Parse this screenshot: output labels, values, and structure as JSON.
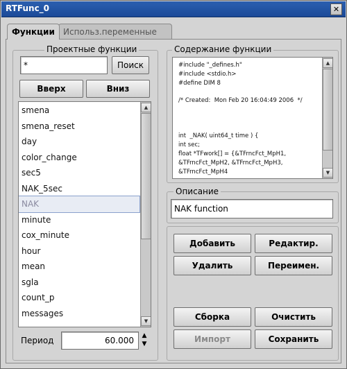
{
  "window": {
    "title": "RTFunc_0",
    "close_glyph": "✕"
  },
  "tabs": [
    {
      "label": "Функции",
      "active": true
    },
    {
      "label": "Использ.переменные",
      "active": false
    }
  ],
  "project_functions": {
    "group_label": "Проектные функции",
    "search_value": "*",
    "search_button": "Поиск",
    "up_button": "Вверх",
    "down_button": "Вниз",
    "items": [
      "smena",
      "smena_reset",
      "day",
      "color_change",
      "sec5",
      "NAK_5sec",
      "NAK",
      "minute",
      "cox_minute",
      "hour",
      "mean",
      "sgla",
      "count_p",
      "messages"
    ],
    "selected_index": 6,
    "period_label": "Период",
    "period_value": "60.000"
  },
  "function_content": {
    "group_label": "Содержание функции",
    "lines": [
      "#include \"_defines.h\"",
      "#include <stdio.h>",
      "#define DIM 8",
      "",
      "/* Created:  Mon Feb 20 16:04:49 2006  */",
      "",
      "",
      "",
      "int  _NAK( uint64_t time ) {",
      "int sec;",
      "float *TFwork[] = {&TFrncFct_MpH1,",
      "&TFrncFct_MpH2, &TFrncFct_MpH3,",
      "&TFrncFct_MpH4"
    ]
  },
  "description": {
    "label": "Описание",
    "value": "NAK function"
  },
  "actions": {
    "add": "Добавить",
    "edit": "Редактир.",
    "delete": "Удалить",
    "rename": "Переимен.",
    "build": "Сборка",
    "clear": "Очистить",
    "import": "Импорт",
    "save": "Сохранить"
  },
  "colors": {
    "title_bar": "#1f4f9f",
    "selected_row_border": "#8aa0cc"
  }
}
